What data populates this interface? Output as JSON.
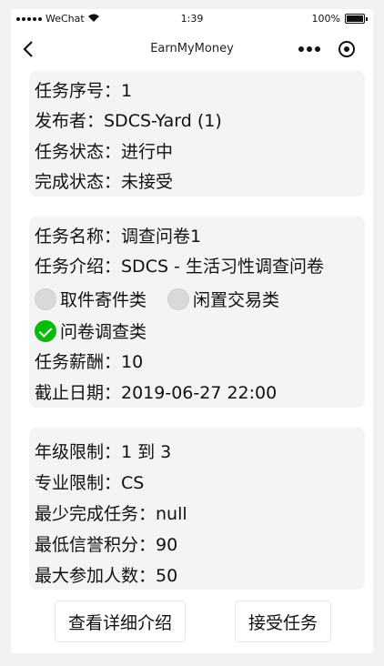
{
  "statusbar": {
    "carrier": "WeChat",
    "time": "1:39",
    "battery": "100%"
  },
  "navbar": {
    "title": "EarnMyMoney"
  },
  "card1": {
    "task_no": "任务序号：1",
    "publisher": "发布者：SDCS-Yard (1)",
    "task_status": "任务状态：进行中",
    "completion_status": "完成状态：未接受"
  },
  "card2": {
    "task_name": "任务名称：调查问卷1",
    "task_intro": "任务介绍：SDCS - 生活习性调查问卷",
    "categories": [
      {
        "label": "取件寄件类",
        "checked": false
      },
      {
        "label": "闲置交易类",
        "checked": false
      },
      {
        "label": "问卷调查类",
        "checked": true
      }
    ],
    "reward": "任务薪酬：10",
    "deadline": "截止日期：2019-06-27 22:00"
  },
  "card3": {
    "grade_limit": "年级限制：1 到 3",
    "major_limit": "专业限制：CS",
    "min_tasks": "最少完成任务：null",
    "min_credit": "最低信誉积分：90",
    "max_participants": "最大参加人数：50"
  },
  "buttons": {
    "detail": "查看详细介绍",
    "accept": "接受任务"
  },
  "colors": {
    "accent": "#09bb07",
    "card_bg": "#f4f4f4"
  }
}
